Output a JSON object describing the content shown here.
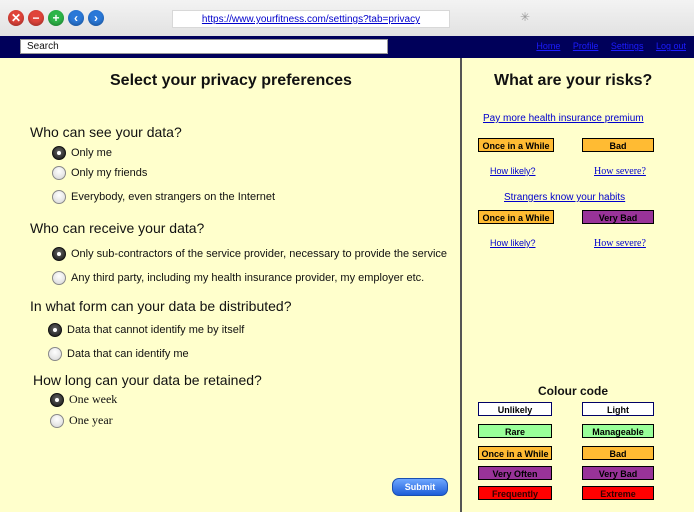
{
  "browser": {
    "url": "https://www.yourfitness.com/settings?tab=privacy"
  },
  "navbar": {
    "search_placeholder": "Search",
    "links": [
      "Home",
      "Profile",
      "Settings",
      "Log out"
    ]
  },
  "left": {
    "title": "Select your privacy preferences",
    "questions": [
      {
        "label": "Who can see your data?",
        "options": [
          "Only me",
          "Only my friends",
          "Everybody, even strangers on the Internet"
        ],
        "selected": 0
      },
      {
        "label": "Who can receive your data?",
        "options": [
          "Only sub-contractors of the service provider, necessary to provide the service",
          "Any third party, including my health insurance provider, my employer etc."
        ],
        "selected": 0
      },
      {
        "label": "In what form can your data be distributed?",
        "options": [
          "Data that cannot identify me by itself",
          "Data that can identify me"
        ],
        "selected": 0
      },
      {
        "label": "How long can your data be retained?",
        "options": [
          "One week",
          "One year"
        ],
        "selected": 0
      }
    ],
    "submit_label": "Submit"
  },
  "right": {
    "title": "What are your risks?",
    "risks": [
      {
        "title": "Pay more health insurance premium",
        "likelihood": "Once in a While",
        "severity": "Bad",
        "likely_link": "How likely?",
        "severe_link": "How severe?"
      },
      {
        "title": "Strangers know your habits",
        "likelihood": "Once in a While",
        "severity": "Very Bad",
        "likely_link": "How likely?",
        "severe_link": "How severe?"
      }
    ],
    "colour_code": {
      "title": "Colour code",
      "rows": [
        {
          "left": "Unlikely",
          "right": "Light"
        },
        {
          "left": "Rare",
          "right": "Manageable"
        },
        {
          "left": "Once in a While",
          "right": "Bad"
        },
        {
          "left": "Very Often",
          "right": "Very Bad"
        },
        {
          "left": "Frequently",
          "right": "Extreme"
        }
      ]
    }
  },
  "colors": {
    "navbar": "#00005a",
    "panel": "#ffffcc",
    "unlikely": "#ffffff",
    "rare": "#99ff99",
    "once": "#ffbb33",
    "very_often": "#993399",
    "frequently": "#ff0000"
  }
}
